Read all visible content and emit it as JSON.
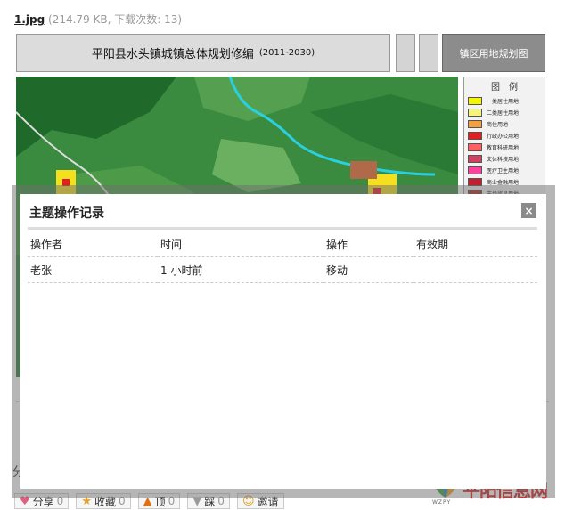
{
  "attachment": {
    "filename": "1.jpg",
    "meta": "(214.79 KB, 下载次数: 13)"
  },
  "map_image": {
    "title": "平阳县水头镇城镇总体规划修编",
    "years": "(2011-2030)",
    "right_label": "镇区用地规划图",
    "legend_title": "图　例",
    "legend": [
      {
        "label": "一类居住用地",
        "color": "#f5f500"
      },
      {
        "label": "二类居住用地",
        "color": "#f5f57a"
      },
      {
        "label": "商住用地",
        "color": "#f5a040"
      },
      {
        "label": "行政办公用地",
        "color": "#e02020"
      },
      {
        "label": "教育科研用地",
        "color": "#ff6060"
      },
      {
        "label": "文体科技用地",
        "color": "#d04060"
      },
      {
        "label": "医疗卫生用地",
        "color": "#ff40a0"
      },
      {
        "label": "商业金融用地",
        "color": "#c02030"
      },
      {
        "label": "市场贸易用地",
        "color": "#a03020"
      },
      {
        "label": "生产设施用地",
        "color": "#8b5a3c"
      }
    ]
  },
  "share_heading": "分",
  "actions": [
    {
      "label": "分享",
      "count": "0",
      "icon": "heart-icon",
      "glyph": "♥",
      "color": "#e06080"
    },
    {
      "label": "收藏",
      "count": "0",
      "icon": "star-icon",
      "glyph": "★",
      "color": "#e8a020"
    },
    {
      "label": "顶",
      "count": "0",
      "icon": "thumb-up-icon",
      "glyph": "▲",
      "color": "#e07010"
    },
    {
      "label": "踩",
      "count": "0",
      "icon": "thumb-down-icon",
      "glyph": "▼",
      "color": "#9a9a9a"
    },
    {
      "label": "邀请",
      "count": "",
      "icon": "invite-icon",
      "glyph": "☺",
      "color": "#e0a020"
    }
  ],
  "watermark": {
    "brand": "平阳信息网",
    "small": "WZPY"
  },
  "modal": {
    "title": "主题操作记录",
    "close_glyph": "×",
    "columns": [
      "操作者",
      "时间",
      "操作",
      "有效期"
    ],
    "rows": [
      [
        "老张",
        "1 小时前",
        "移动",
        ""
      ]
    ]
  }
}
